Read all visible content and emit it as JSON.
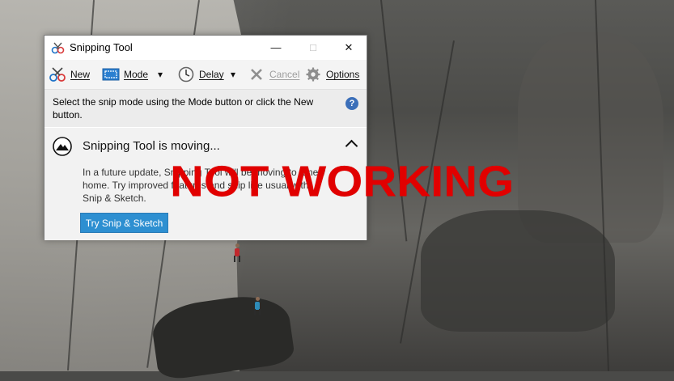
{
  "window": {
    "title": "Snipping Tool",
    "controls": {
      "minimize": "—",
      "maximize": "□",
      "close": "✕"
    }
  },
  "toolbar": {
    "new_label": "New",
    "mode_label": "Mode",
    "delay_label": "Delay",
    "cancel_label": "Cancel",
    "options_label": "Options",
    "mode_dropdown": "▾",
    "delay_dropdown": "▾"
  },
  "hint": {
    "text": "Select the snip mode using the Mode button or click the New button.",
    "help": "?"
  },
  "notice": {
    "title": "Snipping Tool is moving...",
    "body": "In a future update, Snipping Tool will be moving to a new home. Try improved features and snip like usual with Snip & Sketch.",
    "button_label": "Try Snip & Sketch"
  },
  "overlay": {
    "text": "NOT WORKING",
    "color": "#e10000"
  },
  "icons": {
    "app": "scissors-icon",
    "new": "scissors-icon",
    "mode": "mode-icon",
    "delay": "clock-icon",
    "cancel": "x-icon",
    "options": "gear-icon",
    "help": "help-icon",
    "notice": "snip-sketch-icon"
  },
  "colors": {
    "accent": "#2d8fd1",
    "overlay_red": "#e10000"
  }
}
